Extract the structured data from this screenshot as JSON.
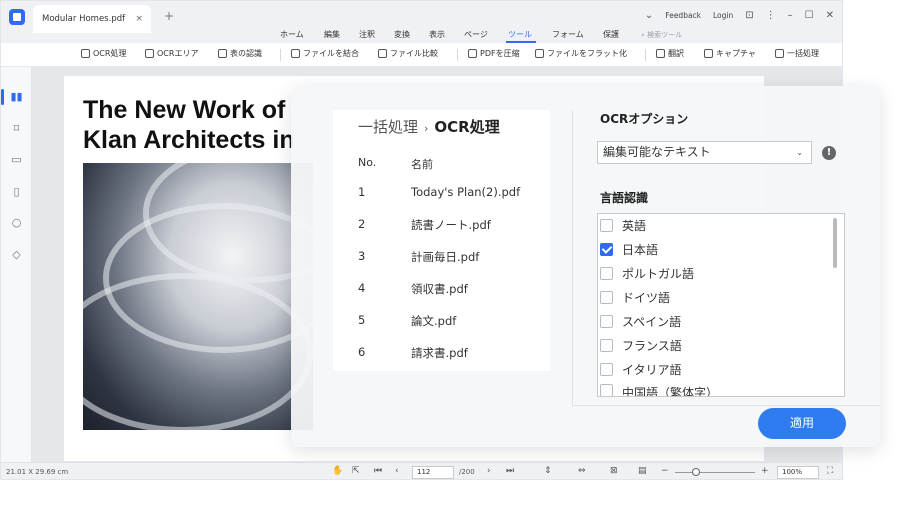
{
  "titlebar": {
    "tab_title": "Modular Homes.pdf",
    "tab_close": "×",
    "new_tab": "+",
    "feedback": "Feedback",
    "login": "Login"
  },
  "menu": [
    "ホーム",
    "編集",
    "注釈",
    "変換",
    "表示",
    "ページ",
    "ツール",
    "フォーム",
    "保護"
  ],
  "menu_active": "ツール",
  "search_tools": "検索ツール",
  "toolbar": [
    "OCR処理",
    "OCRエリア",
    "表の認識",
    "ファイルを結合",
    "ファイル比較",
    "PDFを圧縮",
    "ファイルをフラット化",
    "翻訳",
    "キャプチャ",
    "一括処理"
  ],
  "document": {
    "title_line1": "The New Work of",
    "title_line2": "Klan Architects in"
  },
  "statusbar": {
    "dimensions": "21.01 X 29.69 cm",
    "page_current": "112",
    "page_total": "/200",
    "zoom": "100%"
  },
  "batch": {
    "breadcrumb_parent": "一括処理",
    "breadcrumb_sep": "›",
    "breadcrumb_current": "OCR処理",
    "col_no": "No.",
    "col_name": "名前",
    "files": [
      {
        "no": "1",
        "name": "Today's Plan(2).pdf"
      },
      {
        "no": "2",
        "name": "読書ノート.pdf"
      },
      {
        "no": "3",
        "name": "計画毎日.pdf"
      },
      {
        "no": "4",
        "name": "領収書.pdf"
      },
      {
        "no": "5",
        "name": "論文.pdf"
      },
      {
        "no": "6",
        "name": "請求書.pdf"
      }
    ]
  },
  "ocr_options": {
    "title": "OCRオプション",
    "mode_selected": "編集可能なテキスト",
    "language_title": "言語認識",
    "languages": [
      {
        "label": "英語",
        "checked": false
      },
      {
        "label": "日本語",
        "checked": true
      },
      {
        "label": "ポルトガル語",
        "checked": false
      },
      {
        "label": "ドイツ語",
        "checked": false
      },
      {
        "label": "スペイン語",
        "checked": false
      },
      {
        "label": "フランス語",
        "checked": false
      },
      {
        "label": "イタリア語",
        "checked": false
      },
      {
        "label": "中国語（繁体字）",
        "checked": false
      }
    ],
    "apply_label": "適用"
  },
  "colors": {
    "accent": "#2f6bf0",
    "apply_button": "#2f7cf0"
  }
}
